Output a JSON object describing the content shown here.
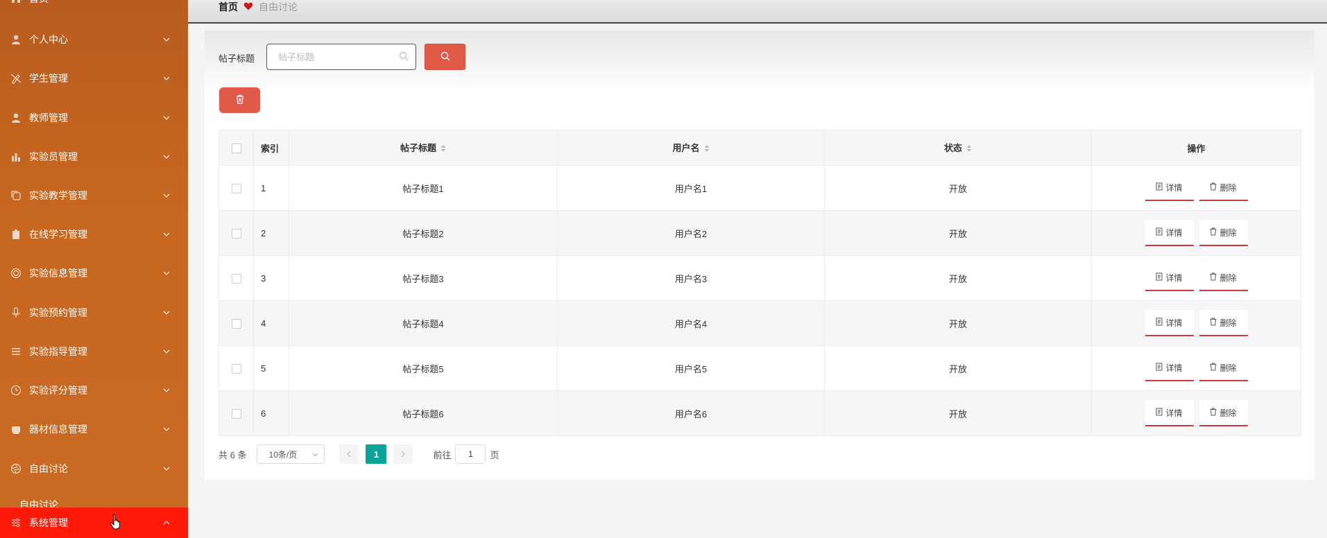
{
  "sidebar": {
    "top_item": "首页",
    "items": [
      {
        "label": "个人中心",
        "icon": "user-icon"
      },
      {
        "label": "学生管理",
        "icon": "edit-off-icon"
      },
      {
        "label": "教师管理",
        "icon": "user-icon"
      },
      {
        "label": "实验员管理",
        "icon": "bar-chart-icon"
      },
      {
        "label": "实验教学管理",
        "icon": "copy-icon"
      },
      {
        "label": "在线学习管理",
        "icon": "clipboard-icon"
      },
      {
        "label": "实验信息管理",
        "icon": "target-icon"
      },
      {
        "label": "实验预约管理",
        "icon": "microphone-icon"
      },
      {
        "label": "实验指导管理",
        "icon": "list-icon"
      },
      {
        "label": "实验评分管理",
        "icon": "clock-icon"
      },
      {
        "label": "器材信息管理",
        "icon": "box-icon"
      },
      {
        "label": "自由讨论",
        "icon": "aperture-icon"
      }
    ],
    "sub_item": "自由讨论",
    "active_item": {
      "label": "系统管理",
      "icon": "sliders-icon",
      "color": "#ff1a0a"
    }
  },
  "breadcrumb": {
    "home": "首页",
    "current": "自由讨论"
  },
  "search": {
    "label": "帖子标题",
    "placeholder": "帖子标题",
    "value": ""
  },
  "colors": {
    "accent": "#e05a47",
    "page_active": "#0aa39a"
  },
  "table": {
    "headers": {
      "index": "索引",
      "title": "帖子标题",
      "username": "用户名",
      "status": "状态",
      "ops": "操作"
    },
    "rows": [
      {
        "index": "1",
        "title": "帖子标题1",
        "username": "用户名1",
        "status": "开放"
      },
      {
        "index": "2",
        "title": "帖子标题2",
        "username": "用户名2",
        "status": "开放"
      },
      {
        "index": "3",
        "title": "帖子标题3",
        "username": "用户名3",
        "status": "开放"
      },
      {
        "index": "4",
        "title": "帖子标题4",
        "username": "用户名4",
        "status": "开放"
      },
      {
        "index": "5",
        "title": "帖子标题5",
        "username": "用户名5",
        "status": "开放"
      },
      {
        "index": "6",
        "title": "帖子标题6",
        "username": "用户名6",
        "status": "开放"
      }
    ],
    "detail_label": "详情",
    "delete_label": "删除"
  },
  "pagination": {
    "total": "共 6 条",
    "page_size": "10条/页",
    "current_page": "1",
    "goto_prefix": "前往",
    "goto_value": "1",
    "goto_suffix": "页"
  }
}
